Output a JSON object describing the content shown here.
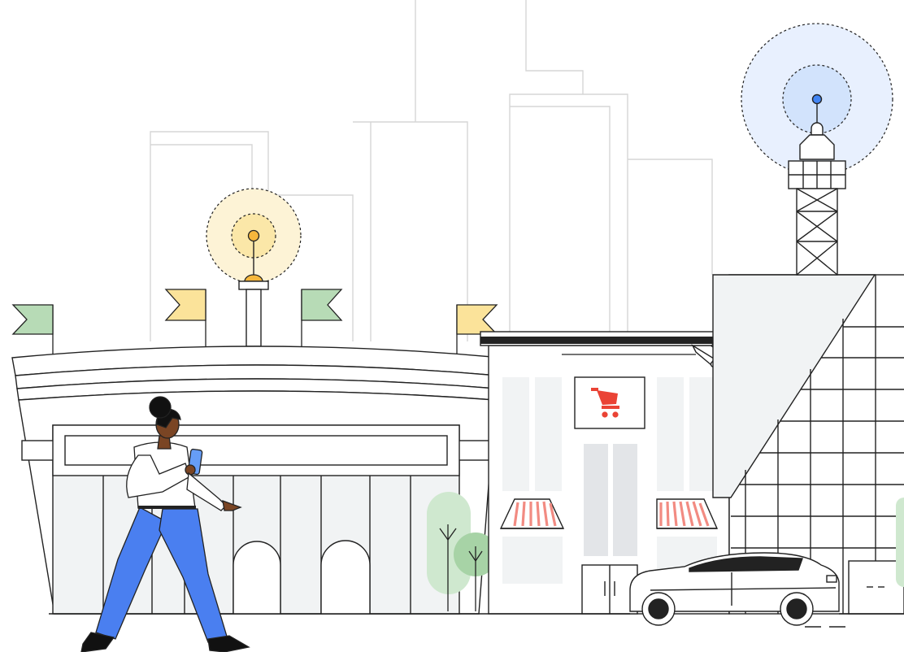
{
  "illustration": {
    "subject": "city-street-scene",
    "palette": {
      "line": "#222222",
      "bg_line": "#d9d9d9",
      "panel": "#f1f3f4",
      "panel_dark": "#e3e5e8",
      "white": "#ffffff",
      "flag_green": "#b7dbb6",
      "flag_yellow": "#fbe39a",
      "signal_yellow_outer": "#fdf3d6",
      "signal_yellow_inner": "#fbe7a8",
      "signal_yellow_dot": "#f6b73c",
      "signal_blue_outer": "#e8f0fe",
      "signal_blue_inner": "#d2e3fc",
      "signal_blue_dot": "#4285f4",
      "cart_red": "#ea4335",
      "awning_red": "#f28b82",
      "tree_light": "#cfe8cf",
      "tree_mid": "#a7d3a6",
      "pants_blue": "#4a7ff0",
      "phone_blue": "#669df6",
      "skin": "#7a4524",
      "hair": "#111111"
    },
    "icons": [
      "shopping-cart-icon",
      "security-camera-icon",
      "wifi-beacon-icon",
      "cell-tower-icon"
    ]
  }
}
